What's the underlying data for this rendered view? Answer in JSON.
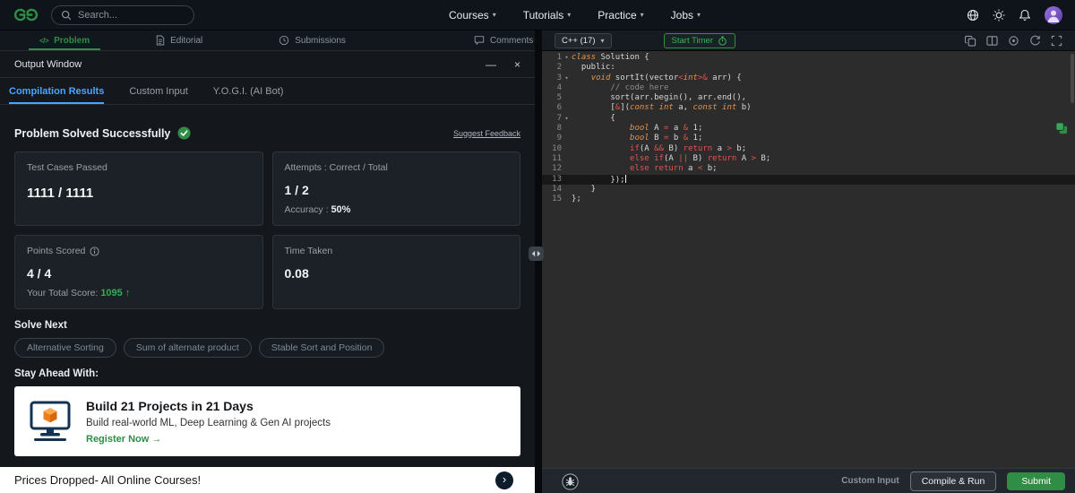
{
  "topbar": {
    "logo_text": "GfG",
    "search_placeholder": "Search...",
    "nav_items": [
      "Courses",
      "Tutorials",
      "Practice",
      "Jobs"
    ]
  },
  "left_tabs": {
    "problem": "Problem",
    "editorial": "Editorial",
    "submissions": "Submissions",
    "comments": "Comments"
  },
  "editor_toolbar": {
    "language": "C++ (17)",
    "start_timer": "Start Timer"
  },
  "output_window": {
    "title": "Output Window",
    "tabs": {
      "compilation": "Compilation Results",
      "custom_input": "Custom Input",
      "yogi": "Y.O.G.I. (AI Bot)"
    },
    "status_text": "Problem Solved Successfully",
    "suggest_feedback": "Suggest Feedback",
    "cards": {
      "test_cases": {
        "label": "Test Cases Passed",
        "value": "1111 / 1111"
      },
      "attempts": {
        "label": "Attempts : Correct / Total",
        "value": "1 / 2",
        "accuracy_label": "Accuracy : ",
        "accuracy_value": "50%"
      },
      "points": {
        "label": "Points Scored",
        "value": "4 / 4",
        "total_label": "Your Total Score: ",
        "total_value": "1095",
        "arrow": "↑"
      },
      "time": {
        "label": "Time Taken",
        "value": "0.08"
      }
    },
    "solve_next_heading": "Solve Next",
    "solve_next_items": [
      "Alternative Sorting",
      "Sum of alternate product",
      "Stable Sort and Position"
    ],
    "stay_ahead_heading": "Stay Ahead With:",
    "promo": {
      "title": "Build 21 Projects in 21 Days",
      "subtitle": "Build real-world ML, Deep Learning & Gen AI projects",
      "cta": "Register Now →"
    },
    "bottom_banner": "Prices Dropped- All Online Courses!"
  },
  "editor": {
    "fold_lines": [
      1,
      3,
      7
    ],
    "active_line": 13,
    "lines": [
      [
        [
          "kw",
          "class "
        ],
        [
          "pl",
          "Solution {"
        ]
      ],
      [
        [
          "pl",
          "  public:"
        ]
      ],
      [
        [
          "pl",
          "    "
        ],
        [
          "kw",
          "void"
        ],
        [
          "pl",
          " sortIt(vector"
        ],
        [
          "op",
          "<"
        ],
        [
          "kw",
          "int"
        ],
        [
          "op",
          ">&"
        ],
        [
          "pl",
          " arr) {"
        ]
      ],
      [
        [
          "cm",
          "        // code here"
        ]
      ],
      [
        [
          "pl",
          "        sort(arr.begin(), arr.end(),"
        ]
      ],
      [
        [
          "pl",
          "        ["
        ],
        [
          "op",
          "&"
        ],
        [
          "pl",
          "]("
        ],
        [
          "kw",
          "const int"
        ],
        [
          "pl",
          " a, "
        ],
        [
          "kw",
          "const int"
        ],
        [
          "pl",
          " b)"
        ]
      ],
      [
        [
          "pl",
          "        {"
        ]
      ],
      [
        [
          "pl",
          "            "
        ],
        [
          "kw",
          "bool"
        ],
        [
          "pl",
          " A "
        ],
        [
          "op",
          "="
        ],
        [
          "pl",
          " a "
        ],
        [
          "op",
          "&"
        ],
        [
          "pl",
          " "
        ],
        [
          "num",
          "1"
        ],
        [
          "pl",
          ";"
        ]
      ],
      [
        [
          "pl",
          "            "
        ],
        [
          "kw",
          "bool"
        ],
        [
          "pl",
          " B "
        ],
        [
          "op",
          "="
        ],
        [
          "pl",
          " b "
        ],
        [
          "op",
          "&"
        ],
        [
          "pl",
          " "
        ],
        [
          "num",
          "1"
        ],
        [
          "pl",
          ";"
        ]
      ],
      [
        [
          "pl",
          "            "
        ],
        [
          "op",
          "if"
        ],
        [
          "pl",
          "(A "
        ],
        [
          "op",
          "&&"
        ],
        [
          "pl",
          " B) "
        ],
        [
          "op",
          "return"
        ],
        [
          "pl",
          " a "
        ],
        [
          "op",
          ">"
        ],
        [
          "pl",
          " b;"
        ]
      ],
      [
        [
          "pl",
          "            "
        ],
        [
          "op",
          "else if"
        ],
        [
          "pl",
          "(A "
        ],
        [
          "op",
          "||"
        ],
        [
          "pl",
          " B) "
        ],
        [
          "op",
          "return"
        ],
        [
          "pl",
          " A "
        ],
        [
          "op",
          ">"
        ],
        [
          "pl",
          " B;"
        ]
      ],
      [
        [
          "pl",
          "            "
        ],
        [
          "op",
          "else return"
        ],
        [
          "pl",
          " a "
        ],
        [
          "op",
          "<"
        ],
        [
          "pl",
          " b;"
        ]
      ],
      [
        [
          "pl",
          "        });"
        ]
      ],
      [
        [
          "pl",
          "    }"
        ]
      ],
      [
        [
          "pl",
          "};"
        ]
      ]
    ]
  },
  "editor_footer": {
    "custom_input": "Custom Input",
    "compile_run": "Compile & Run",
    "submit": "Submit"
  },
  "icons": {
    "chevron": "▾",
    "fold": "▾",
    "minimize": "—",
    "close": "×",
    "code_tag": "</>",
    "banner_arrow": "›",
    "search": "magnifier",
    "translate": "globe",
    "theme": "sun",
    "notifications": "bell",
    "success": "check-circle",
    "info": "info-circle",
    "timer": "stopwatch",
    "debug": "bug",
    "copy_code": "copy-stack"
  },
  "colors": {
    "accent_green": "#2f8d46",
    "tab_blue": "#4da3ff",
    "keyword_orange": "#e8924a",
    "operator_red": "#e5534b",
    "score_green": "#2fae54"
  }
}
